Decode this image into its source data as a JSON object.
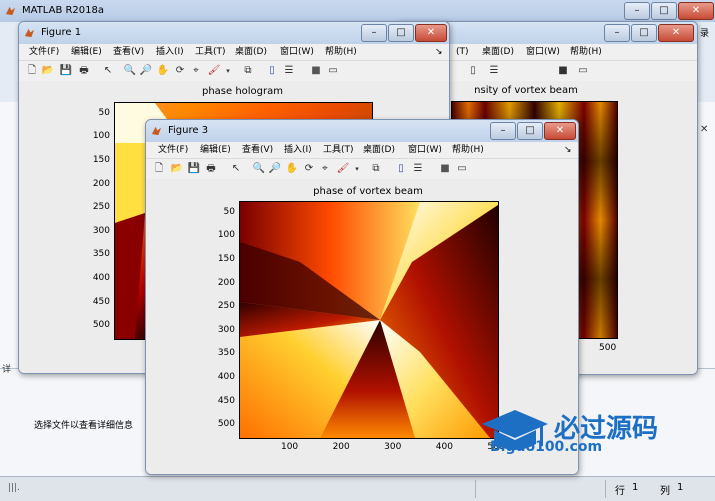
{
  "app": {
    "title": "MATLAB R2018a",
    "partial_labels": [
      "行",
      "1",
      "列",
      "1"
    ],
    "status_row_label": "行",
    "status_row_value": "1",
    "status_col_label": "列",
    "status_col_value": "1",
    "details_hint": "选择文件以查看详细信息",
    "edge_label_right": "录",
    "edge_label_left_bottom": "详"
  },
  "menu": [
    "文件(F)",
    "编辑(E)",
    "查看(V)",
    "插入(I)",
    "工具(T)",
    "桌面(D)",
    "窗口(W)",
    "帮助(H)"
  ],
  "window_buttons": {
    "minimize": "–",
    "maximize": "□",
    "close": "✕"
  },
  "figure1": {
    "title": "Figure 1",
    "plot_title": "phase hologram",
    "yticks": [
      "50",
      "100",
      "150",
      "200",
      "250",
      "300",
      "350",
      "400",
      "450",
      "500"
    ]
  },
  "figure2": {
    "plot_title": "nsity of vortex beam",
    "menu_partial": [
      "(T)",
      "桌面(D)",
      "窗口(W)",
      "帮助(H)"
    ],
    "xtick_visible": "500"
  },
  "figure3": {
    "title": "Figure 3",
    "plot_title": "phase of vortex beam",
    "yticks": [
      "50",
      "100",
      "150",
      "200",
      "250",
      "300",
      "350",
      "400",
      "450",
      "500"
    ],
    "xticks": [
      "100",
      "200",
      "300",
      "400",
      "500"
    ]
  },
  "watermark": {
    "text": "必过源码",
    "url": "Biguo100.com"
  },
  "colormap": "hot"
}
